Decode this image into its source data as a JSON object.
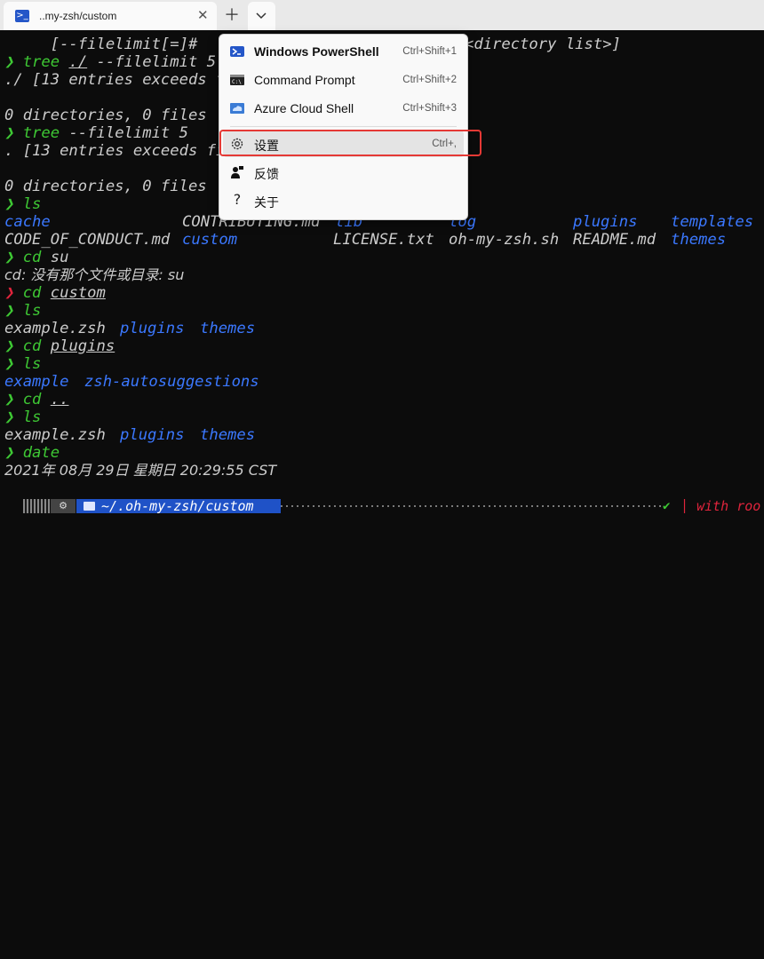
{
  "tab": {
    "title": "..my-zsh/custom",
    "icon": "powershell-icon"
  },
  "dropdown": {
    "items": [
      {
        "label": "Windows PowerShell",
        "shortcut": "Ctrl+Shift+1",
        "icon": "powershell-icon"
      },
      {
        "label": "Command Prompt",
        "shortcut": "Ctrl+Shift+2",
        "icon": "cmd-icon"
      },
      {
        "label": "Azure Cloud Shell",
        "shortcut": "Ctrl+Shift+3",
        "icon": "azure-cloud-icon"
      },
      {
        "label": "设置",
        "shortcut": "Ctrl+,",
        "icon": "gear-icon"
      },
      {
        "label": "反馈",
        "shortcut": "",
        "icon": "feedback-icon"
      },
      {
        "label": "关于",
        "shortcut": "",
        "icon": "help-icon"
      }
    ]
  },
  "terminal": {
    "l0": "     [--filelimit[=]#",
    "l0b": "<directory list>]",
    "l1_cmd": "tree",
    "l1_arg": "./",
    "l1_rest": " --filelimit 5",
    "l2": "./ [13 entries exceeds f",
    "l4": "0 directories, 0 files",
    "l5_cmd": "tree",
    "l5_rest": " --filelimit 5",
    "l6": ". [13 entries exceeds fi",
    "l8": "0 directories, 0 files",
    "l9_cmd": "ls",
    "ls1": [
      "cache",
      "CONTRIBUTING.md",
      "lib",
      "log",
      "plugins",
      "templates"
    ],
    "ls2": [
      "CODE_OF_CONDUCT.md",
      "custom",
      "LICENSE.txt",
      "oh-my-zsh.sh",
      "README.md",
      "themes"
    ],
    "l12_cmd": "cd",
    "l12_arg": " su",
    "l13": "cd: 没有那个文件或目录: su",
    "l14_cmd": "cd",
    "l14_arg": "custom",
    "l15_cmd": "ls",
    "l16": [
      "example.zsh",
      "plugins",
      "themes"
    ],
    "l17_cmd": "cd",
    "l17_arg": "plugins",
    "l18_cmd": "ls",
    "l19": [
      "example",
      "zsh-autosuggestions"
    ],
    "l20_cmd": "cd",
    "l20_arg": "..",
    "l21_cmd": "ls",
    "l22": [
      "example.zsh",
      "plugins",
      "themes"
    ],
    "l23_cmd": "date",
    "l24": "2021年 08月 29日 星期日 20:29:55 CST"
  },
  "statusbar": {
    "path": "~/.oh-my-zsh/custom",
    "check": "✔",
    "right": "with roo"
  },
  "colors": {
    "green": "#3ec834",
    "blue": "#3b78ff",
    "red": "#e0243c",
    "highlight": "#e53935"
  }
}
